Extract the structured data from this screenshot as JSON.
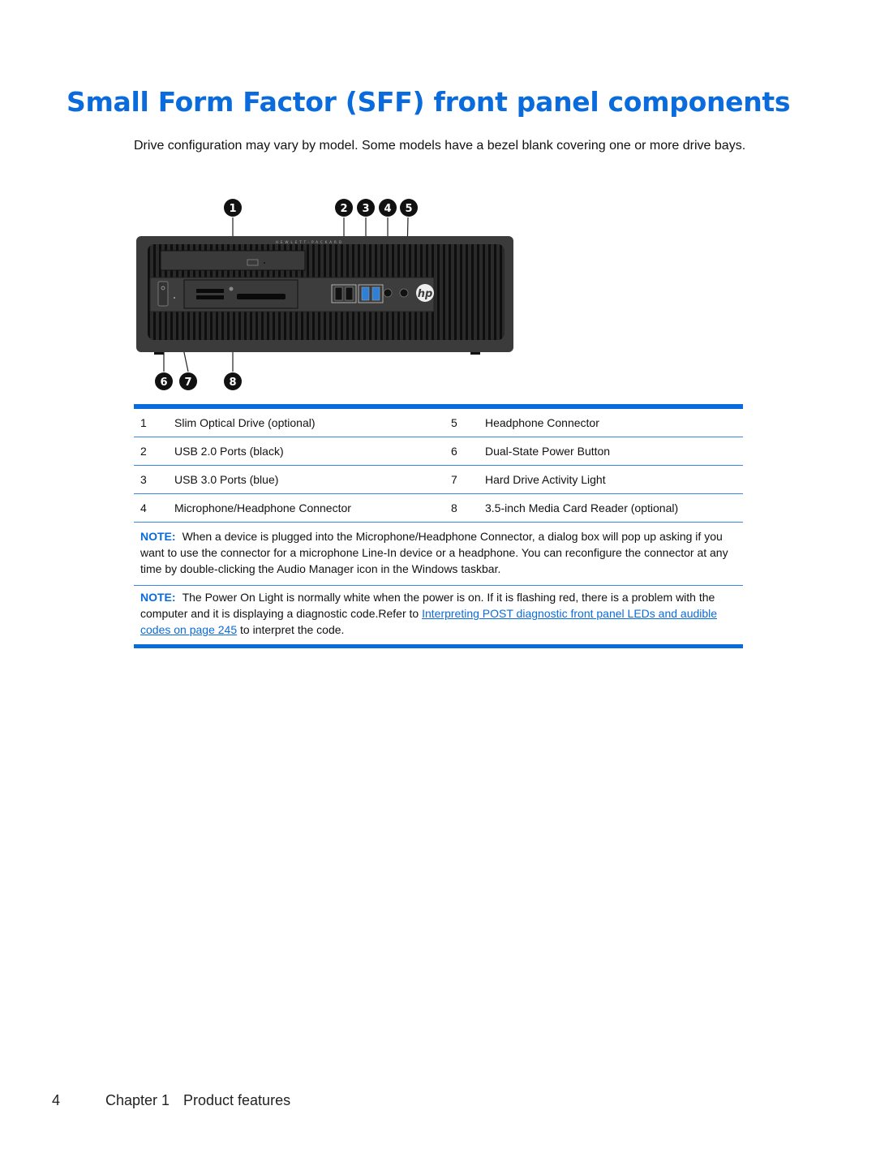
{
  "page": {
    "title": "Small Form Factor (SFF) front panel components",
    "intro": "Drive configuration may vary by model. Some models have a bezel blank covering one or more drive bays."
  },
  "figure": {
    "description": "HP SFF desktop front panel with numbered callouts",
    "callouts": [
      "1",
      "2",
      "3",
      "4",
      "5",
      "6",
      "7",
      "8"
    ],
    "brand_text": "HEWLETT-PACKARD",
    "logo": "hp",
    "colors": {
      "chassis": "#3a3a3a",
      "usb3": "#2f7fd6",
      "callout": "#111111"
    }
  },
  "table": {
    "rows": [
      {
        "n1": "1",
        "l1": "Slim Optical Drive (optional)",
        "n2": "5",
        "l2": "Headphone Connector"
      },
      {
        "n1": "2",
        "l1": "USB 2.0 Ports (black)",
        "n2": "6",
        "l2": "Dual-State Power Button"
      },
      {
        "n1": "3",
        "l1": "USB 3.0 Ports (blue)",
        "n2": "7",
        "l2": "Hard Drive Activity Light"
      },
      {
        "n1": "4",
        "l1": "Microphone/Headphone Connector",
        "n2": "8",
        "l2": "3.5-inch Media Card Reader (optional)"
      }
    ]
  },
  "notes": [
    {
      "label": "NOTE:",
      "text": "When a device is plugged into the Microphone/Headphone Connector, a dialog box will pop up asking if you want to use the connector for a microphone Line-In device or a headphone. You can reconfigure the connector at any time by double-clicking the Audio Manager icon in the Windows taskbar."
    },
    {
      "label": "NOTE:",
      "text_before": "The Power On Light is normally white when the power is on. If it is flashing red, there is a problem with the computer and it is displaying a diagnostic code.Refer to ",
      "link": "Interpreting POST diagnostic front panel LEDs and audible codes on page 245",
      "text_after": " to interpret the code."
    }
  ],
  "footer": {
    "page_number": "4",
    "chapter": "Chapter 1",
    "section": "Product features"
  },
  "colors": {
    "accent": "#0a6bdc",
    "rule": "#3a86e8"
  }
}
